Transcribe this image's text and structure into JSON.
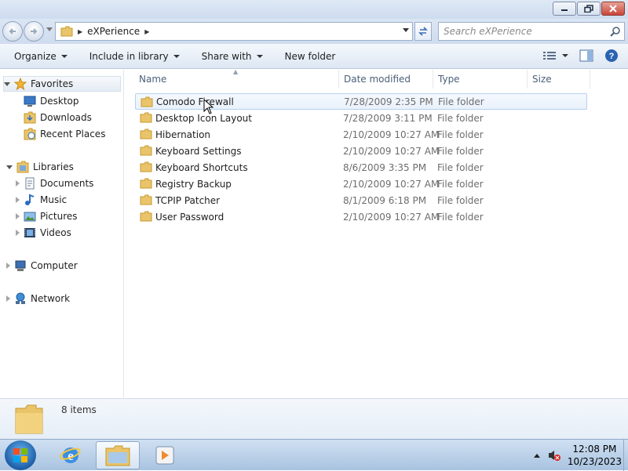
{
  "address": {
    "crumbs": [
      "eXPerience"
    ],
    "search_placeholder": "Search eXPerience"
  },
  "toolbar": {
    "organize": "Organize",
    "include_in_library": "Include in library",
    "share_with": "Share with",
    "new_folder": "New folder"
  },
  "nav": {
    "favorites": "Favorites",
    "desktop": "Desktop",
    "downloads": "Downloads",
    "recent_places": "Recent Places",
    "libraries": "Libraries",
    "documents": "Documents",
    "music": "Music",
    "pictures": "Pictures",
    "videos": "Videos",
    "computer": "Computer",
    "network": "Network"
  },
  "columns": {
    "name": "Name",
    "date_modified": "Date modified",
    "type": "Type",
    "size": "Size"
  },
  "files": [
    {
      "name": "Comodo Firewall",
      "date": "7/28/2009 2:35 PM",
      "type": "File folder"
    },
    {
      "name": "Desktop Icon Layout",
      "date": "7/28/2009 3:11 PM",
      "type": "File folder"
    },
    {
      "name": "Hibernation",
      "date": "2/10/2009 10:27 AM",
      "type": "File folder"
    },
    {
      "name": "Keyboard Settings",
      "date": "2/10/2009 10:27 AM",
      "type": "File folder"
    },
    {
      "name": "Keyboard Shortcuts",
      "date": "8/6/2009 3:35 PM",
      "type": "File folder"
    },
    {
      "name": "Registry Backup",
      "date": "2/10/2009 10:27 AM",
      "type": "File folder"
    },
    {
      "name": "TCPIP Patcher",
      "date": "8/1/2009 6:18 PM",
      "type": "File folder"
    },
    {
      "name": "User Password",
      "date": "2/10/2009 10:27 AM",
      "type": "File folder"
    }
  ],
  "details": {
    "count": "8 items"
  },
  "taskbar": {
    "time": "12:08 PM",
    "date": "10/23/2023"
  },
  "colors": {
    "folder": "#e9c46a",
    "folder_dark": "#d4a83a",
    "accent": "#1c5ea8"
  }
}
